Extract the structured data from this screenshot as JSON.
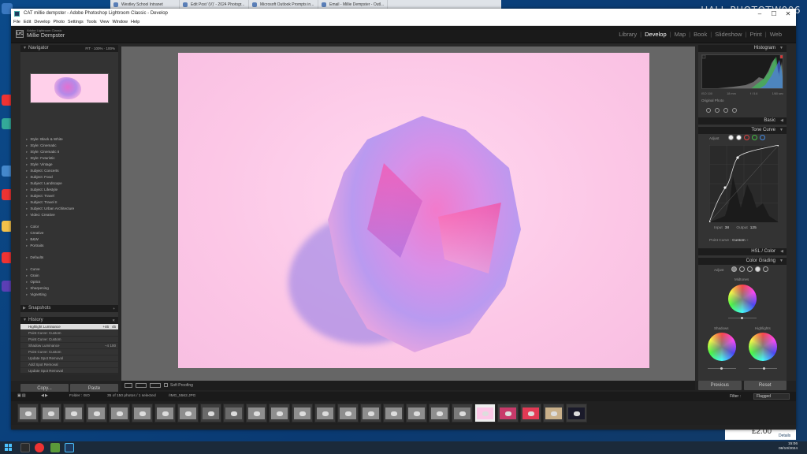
{
  "desktop": {
    "hostname": "HALL-PHOTOTW006",
    "notification": {
      "amount": "£2.00",
      "details": "Details"
    }
  },
  "browser_tabs": [
    "Westley School Intranet",
    "Edit Post '(V)' - 2024 Photogr...",
    "Microsoft Outlook Prompts in...",
    "Email - Millie Dempster - Outl..."
  ],
  "window": {
    "title": "CAT millie dempster - Adobe Photoshop Lightroom Classic - Develop",
    "controls": {
      "minimize": "–",
      "maximize": "☐",
      "close": "✕"
    },
    "menu": [
      "File",
      "Edit",
      "Develop",
      "Photo",
      "Settings",
      "Tools",
      "View",
      "Window",
      "Help"
    ]
  },
  "lr": {
    "logo": "LrC",
    "app_name": "Adobe Lightroom Classic",
    "user": "Millie Dempster",
    "modules": [
      "Library",
      "Develop",
      "Map",
      "Book",
      "Slideshow",
      "Print",
      "Web"
    ],
    "active_module": "Develop"
  },
  "left_panel": {
    "navigator": {
      "title": "Navigator",
      "zoom": "FIT  ·  100%  ·  100%"
    },
    "presets": [
      "Style: Black & White",
      "Style: Cinematic",
      "Style: Cinematic II",
      "Style: Futuristic",
      "Style: Vintage",
      "Subject: Concerts",
      "Subject: Food",
      "Subject: Landscape",
      "Subject: Lifestyle",
      "Subject: Travel",
      "Subject: Travel II",
      "Subject: Urban Architecture",
      "Video: Creative"
    ],
    "presets2": [
      "Color",
      "Creative",
      "B&W",
      "Portraits"
    ],
    "presets3": [
      "Defaults"
    ],
    "presets4": [
      "Curve",
      "Grain",
      "Optics",
      "Sharpening",
      "Vignetting"
    ],
    "snapshots_title": "Snapshots",
    "history_title": "History",
    "history": [
      {
        "label": "Highlight Luminance",
        "v1": "+46",
        "v2": "45"
      },
      {
        "label": "Point Curve: Custom",
        "v1": "",
        "v2": ""
      },
      {
        "label": "Point Curve: Custom",
        "v1": "",
        "v2": ""
      },
      {
        "label": "Shadow Luminance",
        "v1": "–4",
        "v2": "100"
      },
      {
        "label": "Point Curve: Custom",
        "v1": "",
        "v2": ""
      },
      {
        "label": "Update Spot Removal",
        "v1": "",
        "v2": ""
      },
      {
        "label": "Add Spot Removal",
        "v1": "",
        "v2": ""
      },
      {
        "label": "Update Spot Removal",
        "v1": "",
        "v2": ""
      }
    ],
    "copy_label": "Copy...",
    "paste_label": "Paste"
  },
  "toolbar": {
    "soft_proofing": "Soft Proofing"
  },
  "right_panel": {
    "histogram_title": "Histogram",
    "hist_info": [
      "ISO 100",
      "18 mm",
      "f / 5.6",
      "1/60 sec"
    ],
    "original_photo": "Original Photo",
    "basic_title": "Basic",
    "tone_curve_title": "Tone Curve",
    "adjust_label": "Adjust",
    "input_label": "Input",
    "input_value": "38",
    "output_label": "Output",
    "output_value": "125",
    "point_curve_label": "Point Curve :",
    "point_curve_value": "Custom",
    "hsl_title": "HSL / Color",
    "color_grading_title": "Color Grading",
    "midtones_label": "Midtones",
    "shadows_label": "Shadows",
    "highlights_label": "Highlights",
    "previous_label": "Previous",
    "reset_label": "Reset"
  },
  "filmstrip": {
    "source": "Folder : ISO",
    "count": "35 of 150 photos / 1 selected",
    "filename": "/IMG_5562.JPG",
    "filter_label": "Filter :",
    "filter_value": "Flagged"
  },
  "clock": {
    "time": "15:06",
    "date": "08/10/2024"
  },
  "colors": {
    "accent": "#4cc2ff",
    "panel": "#333333",
    "photo_bg": "#fcc7e6"
  }
}
